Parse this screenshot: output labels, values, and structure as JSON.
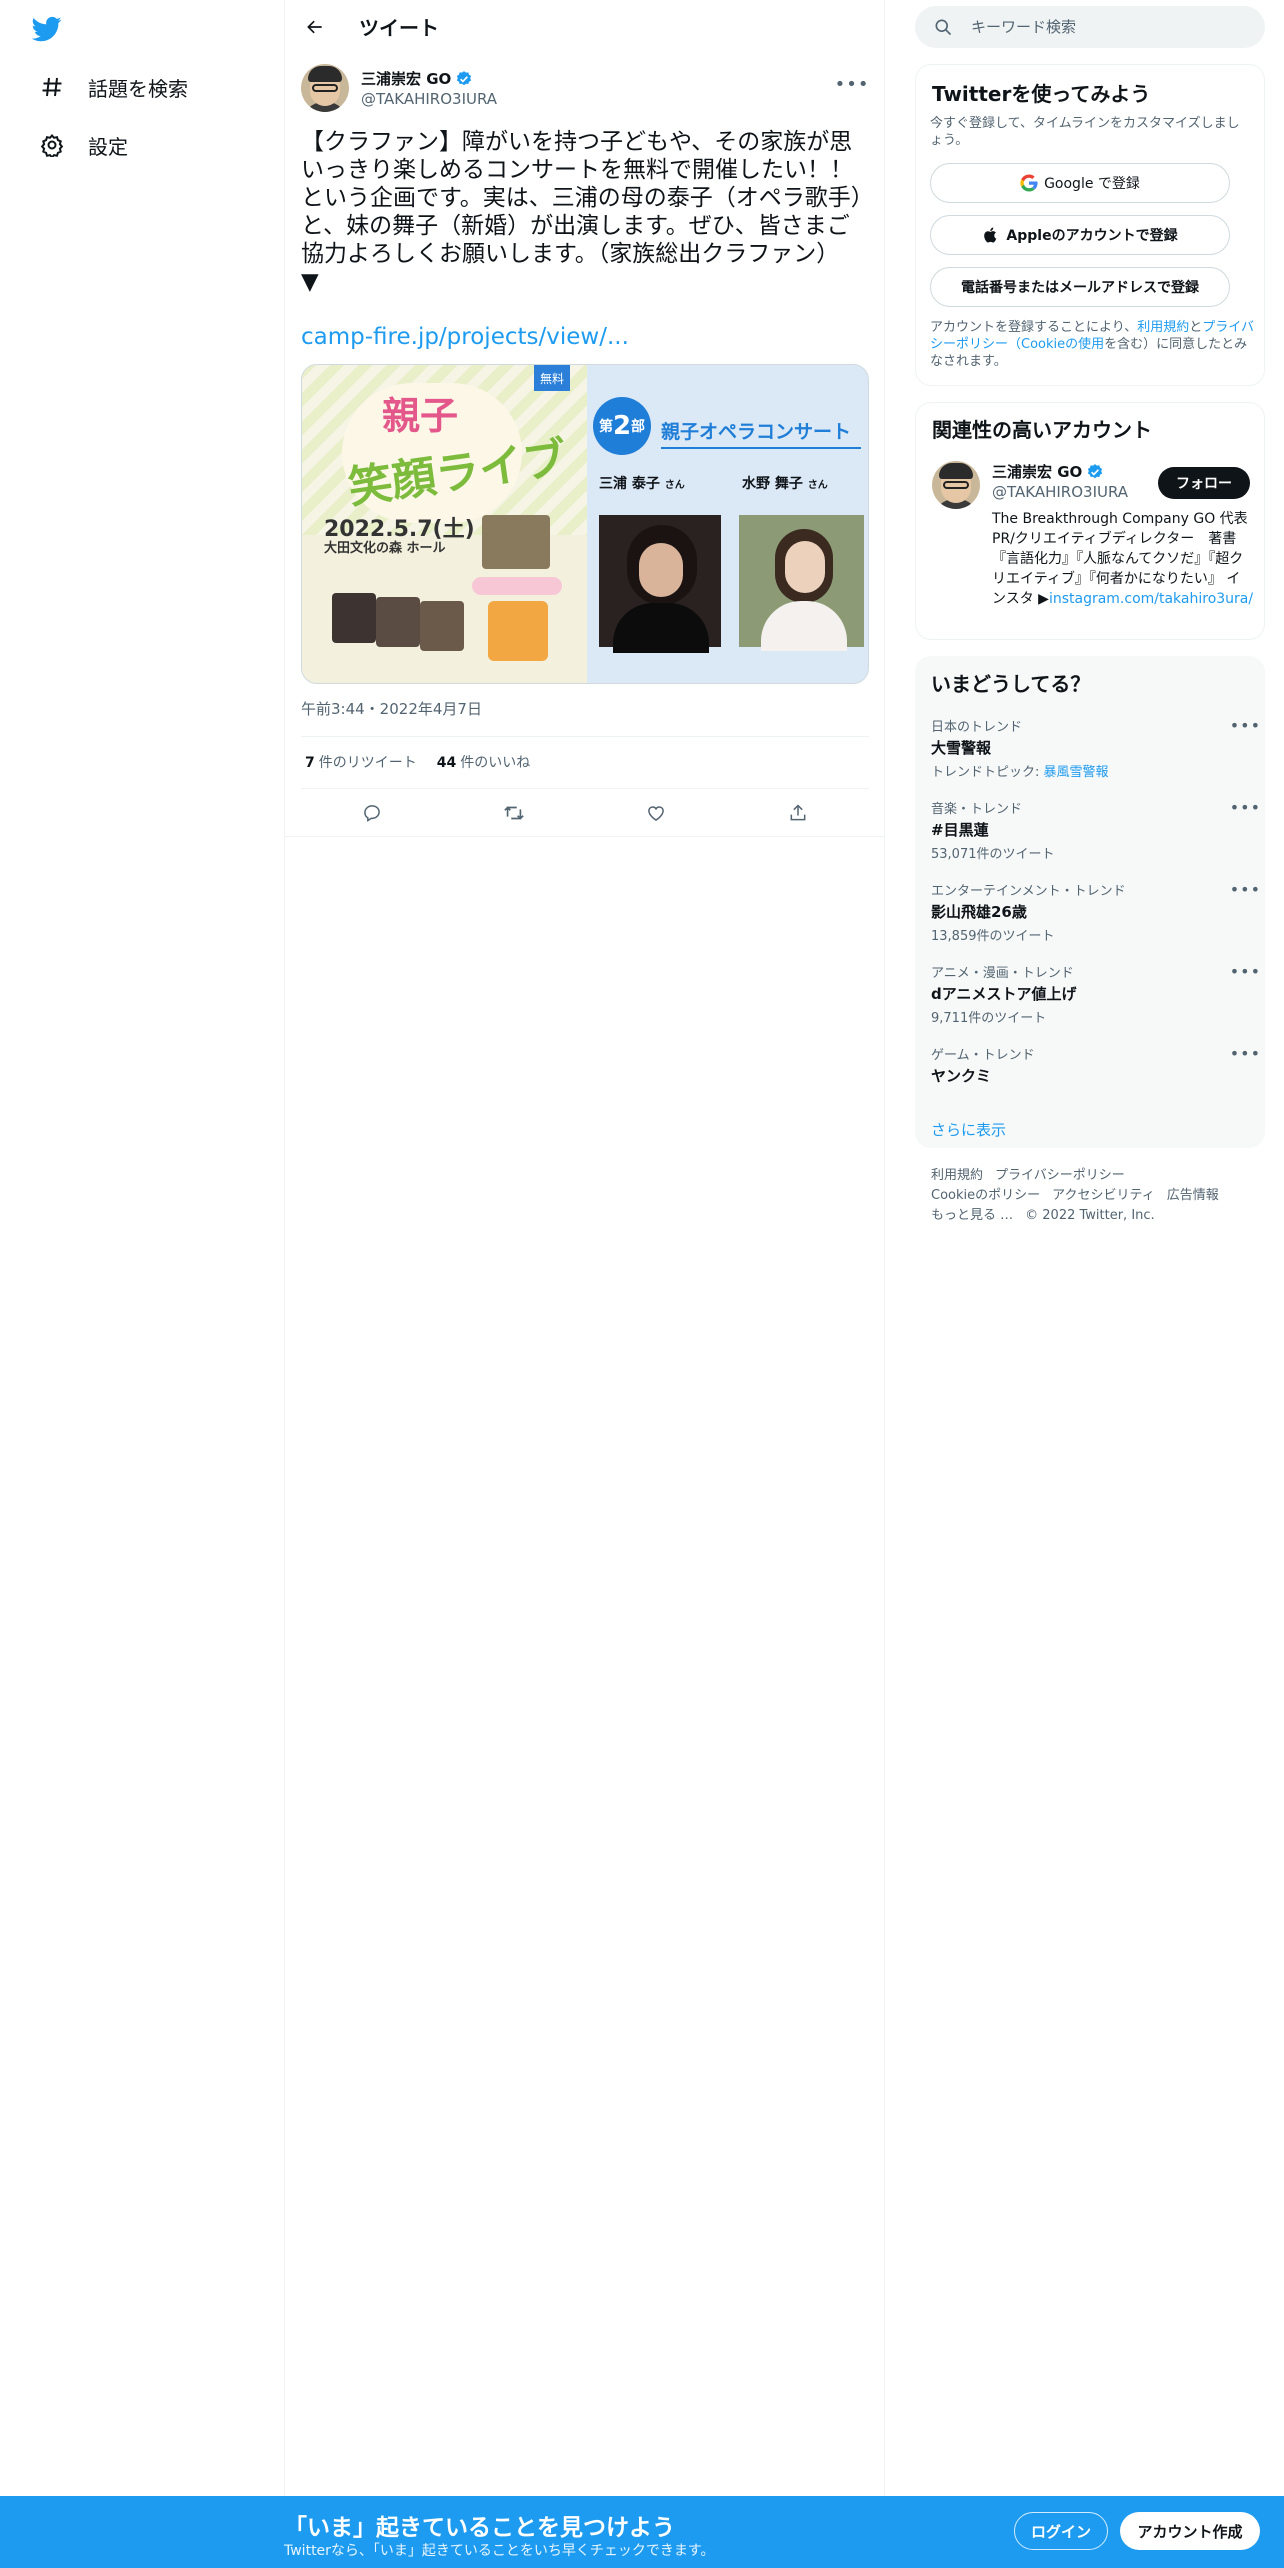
{
  "nav": {
    "items": [
      {
        "label": "話題を検索",
        "icon": "hashtag-icon"
      },
      {
        "label": "設定",
        "icon": "gear-icon"
      }
    ]
  },
  "header": {
    "title": "ツイート"
  },
  "tweet": {
    "author_name": "三浦崇宏 GO",
    "author_handle": "@TAKAHIRO3IURA",
    "text": "【クラファン】障がいを持つ子どもや、その家族が思いっきり楽しめるコンサートを無料で開催したい！！という企画です。実は、三浦の母の泰子（オペラ歌手）と、妹の舞子（新婚）が出演します。ぜひ、皆さまご協力よろしくお願いします。（家族総出クラファン）\n▼",
    "link": "camp-fire.jp/projects/view/...",
    "timestamp": "午前3:44・2022年4月7日",
    "retweets": "7",
    "retweets_label": "件のリツイート",
    "likes": "44",
    "likes_label": "件のいいね"
  },
  "poster": {
    "title1": "親子",
    "title2": "笑顔ライブ",
    "free": "無料",
    "date": "2022.5.7(土)",
    "venue": "大田文化の森 ホール",
    "badge_prefix": "第",
    "badge_num": "2",
    "badge_suffix": "部",
    "concert": "親子オペラコンサート",
    "performer1": "三浦 泰子",
    "performer2": "水野 舞子",
    "san": "さん"
  },
  "search": {
    "placeholder": "キーワード検索"
  },
  "signup_card": {
    "title": "Twitterを使ってみよう",
    "sub": "今すぐ登録して、タイムラインをカスタマイズしましょう。",
    "google": "Google で登録",
    "apple": "Appleのアカウントで登録",
    "phone": "電話番号またはメールアドレスで登録",
    "terms_prefix": "アカウントを登録することにより、",
    "terms_link1": "利用規約",
    "terms_mid": "と",
    "terms_link2": "プライバシーポリシー（Cookieの使用",
    "terms_suffix": "を含む）に同意したとみなされます。"
  },
  "related": {
    "title": "関連性の高いアカウント",
    "name": "三浦崇宏 GO",
    "handle": "@TAKAHIRO3IURA",
    "follow": "フォロー",
    "bio": "The Breakthrough Company GO 代表 PR/クリエイティブディレクター　著書『言語化力』『人脈なんてクソだ』『超クリエイティブ』『何者かになりたい』 インスタ ▶",
    "bio_link": "instagram.com/takahiro3ura/"
  },
  "trends": {
    "title": "いまどうしてる？",
    "items": [
      {
        "context": "日本のトレンド",
        "name": "大雪警報",
        "count_prefix": "トレンドトピック: ",
        "count_link": "暴風雪警報",
        "count": ""
      },
      {
        "context": "音楽・トレンド",
        "name": "#目黒蓮",
        "count": "53,071件のツイート"
      },
      {
        "context": "エンターテインメント・トレンド",
        "name": "影山飛雄26歳",
        "count": "13,859件のツイート"
      },
      {
        "context": "アニメ・漫画・トレンド",
        "name": "dアニメストア値上げ",
        "count": "9,711件のツイート"
      },
      {
        "context": "ゲーム・トレンド",
        "name": "ヤンクミ",
        "count": ""
      }
    ],
    "show_more": "さらに表示"
  },
  "footer": {
    "links": [
      "利用規約",
      "プライバシーポリシー",
      "Cookieのポリシー",
      "アクセシビリティ",
      "広告情報",
      "もっと見る …",
      "© 2022 Twitter, Inc."
    ]
  },
  "banner": {
    "title": "「いま」起きていることを見つけよう",
    "sub": "Twitterなら、「いま」起きていることをいち早くチェックできます。",
    "login": "ログイン",
    "signup": "アカウント作成"
  },
  "colors": {
    "accent": "#1d9bf0",
    "text": "#0f1419",
    "secondary": "#536471"
  }
}
